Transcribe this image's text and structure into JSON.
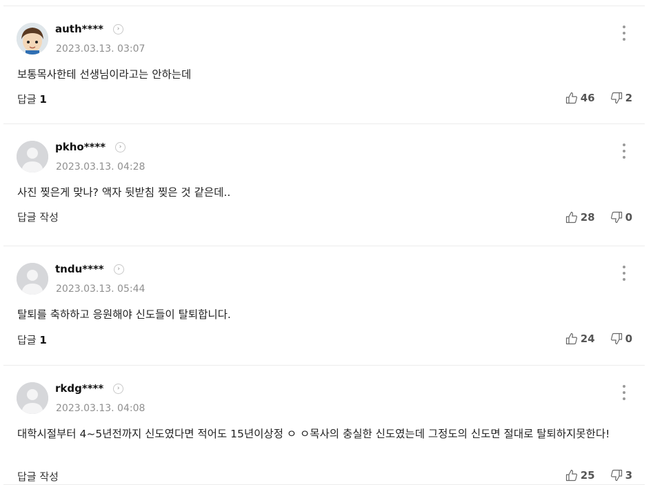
{
  "labels": {
    "reply": "답글",
    "write_reply": "답글 작성"
  },
  "colors": {
    "text": "#222222",
    "date": "#8f8f8f",
    "divider": "#ececec",
    "default_avatar": "#d6d7da"
  },
  "comments": [
    {
      "author": "auth****",
      "date": "2023.03.13. 03:07",
      "avatar": "character-avatar",
      "text": "보통목사한테 선생님이라고는 안하는데",
      "reply_count": "1",
      "likes": "46",
      "dislikes": "2"
    },
    {
      "author": "pkho****",
      "date": "2023.03.13. 04:28",
      "avatar": "default-avatar",
      "text": "사진 찢은게 맞나? 액자 뒷받침 찢은 것 같은데..",
      "reply_count": null,
      "likes": "28",
      "dislikes": "0"
    },
    {
      "author": "tndu****",
      "date": "2023.03.13. 05:44",
      "avatar": "default-avatar",
      "text": "탈퇴를 축하하고 응원해야 신도들이 탈퇴합니다.",
      "reply_count": "1",
      "likes": "24",
      "dislikes": "0"
    },
    {
      "author": "rkdg****",
      "date": "2023.03.13. 04:08",
      "avatar": "default-avatar",
      "text": "대학시절부터 4~5년전까지 신도였다면 적어도 15년이상정 ㅇ ㅇ목사의 충실한 신도였는데 그정도의 신도면 절대로 탈퇴하지못한다!",
      "reply_count": null,
      "likes": "25",
      "dislikes": "3"
    }
  ]
}
